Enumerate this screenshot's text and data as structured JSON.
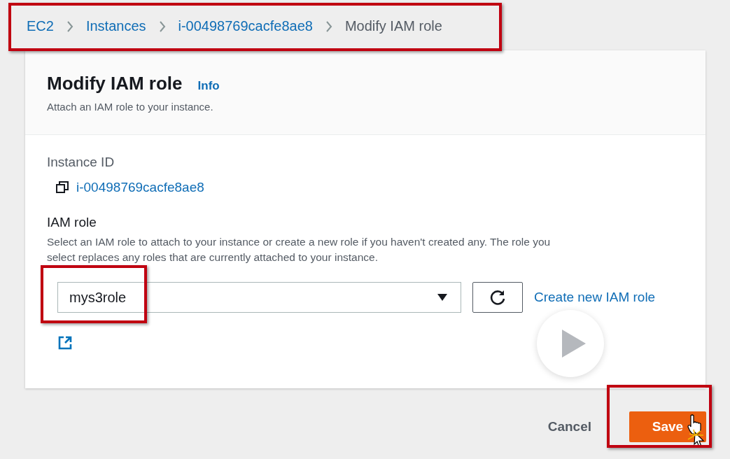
{
  "breadcrumbs": [
    {
      "label": "EC2",
      "kind": "link"
    },
    {
      "label": "Instances",
      "kind": "link"
    },
    {
      "label": "i-00498769cacfe8ae8",
      "kind": "link"
    },
    {
      "label": "Modify IAM role",
      "kind": "current"
    }
  ],
  "panel": {
    "title": "Modify IAM role",
    "info": "Info",
    "description": "Attach an IAM role to your instance."
  },
  "instance": {
    "label": "Instance ID",
    "value": "i-00498769cacfe8ae8"
  },
  "iam_role": {
    "label": "IAM role",
    "description_lines": [
      "Select an IAM role to attach to your instance or create a new role if you haven't created any. The role you",
      "select replaces any roles that are currently attached to your instance."
    ],
    "value": "mys3role",
    "create_link": "Create new IAM role"
  },
  "buttons": [
    {
      "label": "Cancel",
      "kind": "secondary"
    },
    {
      "label": "Save",
      "kind": "primary"
    }
  ]
}
